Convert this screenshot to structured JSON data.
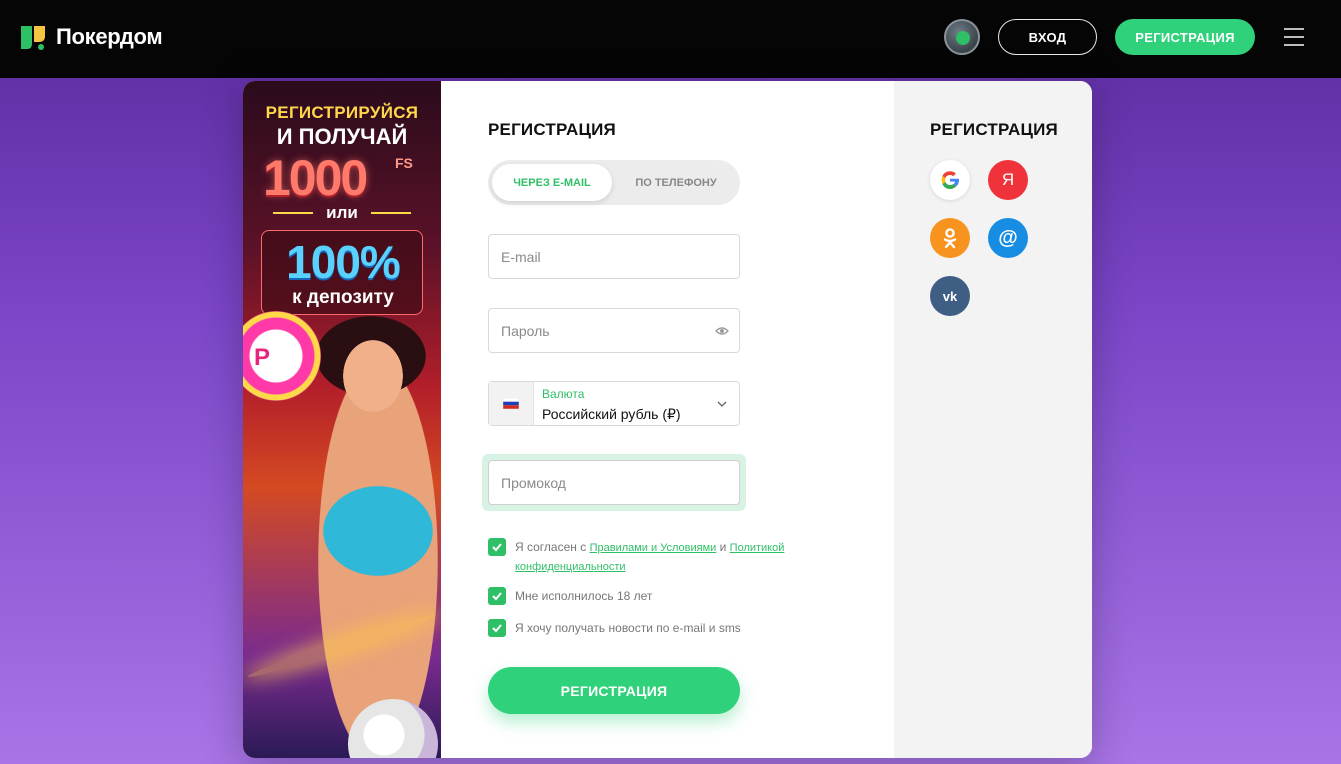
{
  "header": {
    "brand": "Покердом",
    "login_label": "ВХОД",
    "register_label": "РЕГИСТРАЦИЯ"
  },
  "banner": {
    "line1": "РЕГИСТРИРУЙСЯ",
    "line2": "И ПОЛУЧАЙ",
    "big_amount": "1000",
    "fs": "FS",
    "or": "или",
    "percent": "100%",
    "deposit": "к депозиту"
  },
  "form": {
    "title": "РЕГИСТРАЦИЯ",
    "tab_email": "ЧЕРЕЗ E-MAIL",
    "tab_phone": "ПО ТЕЛЕФОНУ",
    "email_placeholder": "E-mail",
    "password_placeholder": "Пароль",
    "currency_label": "Валюта",
    "currency_value": "Российский рубль (₽)",
    "promo_placeholder": "Промокод",
    "agree_prefix": "Я согласен с ",
    "agree_link_rules": "Правилами и Условиями",
    "agree_and": " и ",
    "agree_link_privacy_1": "Политикой",
    "agree_link_privacy_2": "конфиденциальности",
    "age_label": "Мне исполнилось 18 лет",
    "news_label": "Я хочу получать новости по e-mail и sms",
    "submit_label": "РЕГИСТРАЦИЯ"
  },
  "social": {
    "title": "РЕГИСТРАЦИЯ",
    "providers": [
      "google-icon",
      "yandex-icon",
      "ok-icon",
      "mail-icon",
      "vk-icon"
    ],
    "yandex_glyph": "Я",
    "mail_glyph": "@",
    "vk_glyph": "vk"
  },
  "colors": {
    "accent": "#2fd17a",
    "header_bg": "#050505",
    "page_bg_top": "#5a2a9c",
    "page_bg_bottom": "#a874e6"
  }
}
